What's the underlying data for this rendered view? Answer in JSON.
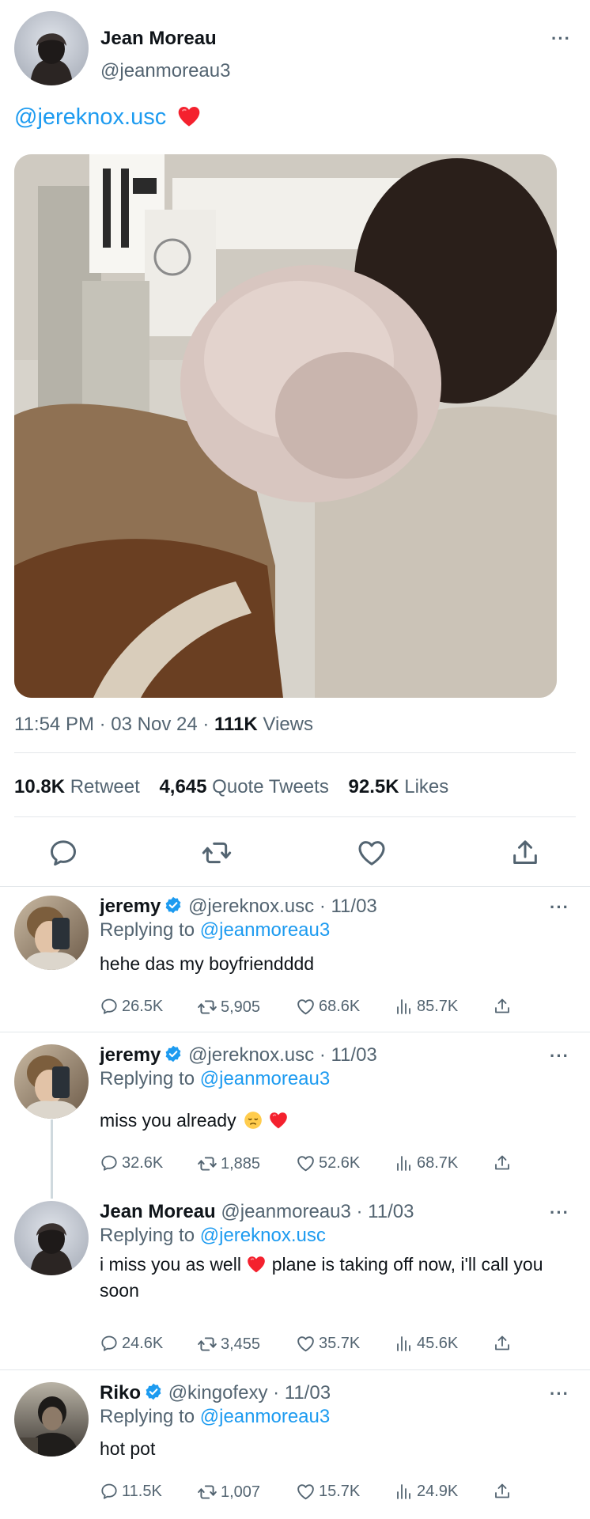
{
  "main": {
    "name": "Jean Moreau",
    "handle": "@jeanmoreau3",
    "text": "@jereknox.usc",
    "time": "11:54 PM · 03 Nov 24 · ",
    "views_count": "111K",
    "views_label": " Views",
    "retweets_count": "10.8K",
    "retweets_label": "Retweet",
    "quotes_count": "4,645",
    "quotes_label": "Quote Tweets",
    "likes_count": "92.5K",
    "likes_label": "Likes"
  },
  "replies": [
    {
      "name": "jeremy",
      "handle": "@jereknox.usc · 11/03",
      "replying_prefix": "Replying to ",
      "replying_to": "@jeanmoreau3",
      "text": "hehe das my boyfriendddd",
      "replies": "26.5K",
      "retweets": "5,905",
      "likes": "68.6K",
      "views": "85.7K"
    },
    {
      "name": "jeremy",
      "handle": "@jereknox.usc · 11/03",
      "replying_prefix": "Replying to ",
      "replying_to": "@jeanmoreau3",
      "text": "miss you already",
      "replies": "32.6K",
      "retweets": "1,885",
      "likes": "52.6K",
      "views": "68.7K"
    },
    {
      "name": "Jean Moreau",
      "handle": "@jeanmoreau3 · 11/03",
      "replying_prefix": "Replying to ",
      "replying_to": "@jereknox.usc",
      "text_a": "i miss you as well",
      "text_b": " plane is taking off now, i'll call you soon",
      "replies": "24.6K",
      "retweets": "3,455",
      "likes": "35.7K",
      "views": "45.6K"
    },
    {
      "name": "Riko",
      "handle": "@kingofexy · 11/03",
      "replying_prefix": "Replying to ",
      "replying_to": "@jeanmoreau3",
      "text": "hot pot",
      "replies": "11.5K",
      "retweets": "1,007",
      "likes": "15.7K",
      "views": "24.9K"
    }
  ],
  "colors": {
    "link": "#1d9bf0",
    "muted": "#536471",
    "text": "#0f1419",
    "heart": "#f4212e"
  },
  "icons": [
    "more-icon",
    "reply-icon",
    "retweet-icon",
    "like-icon",
    "share-icon",
    "views-icon",
    "verified-icon",
    "heart-emoji",
    "sad-emoji"
  ]
}
